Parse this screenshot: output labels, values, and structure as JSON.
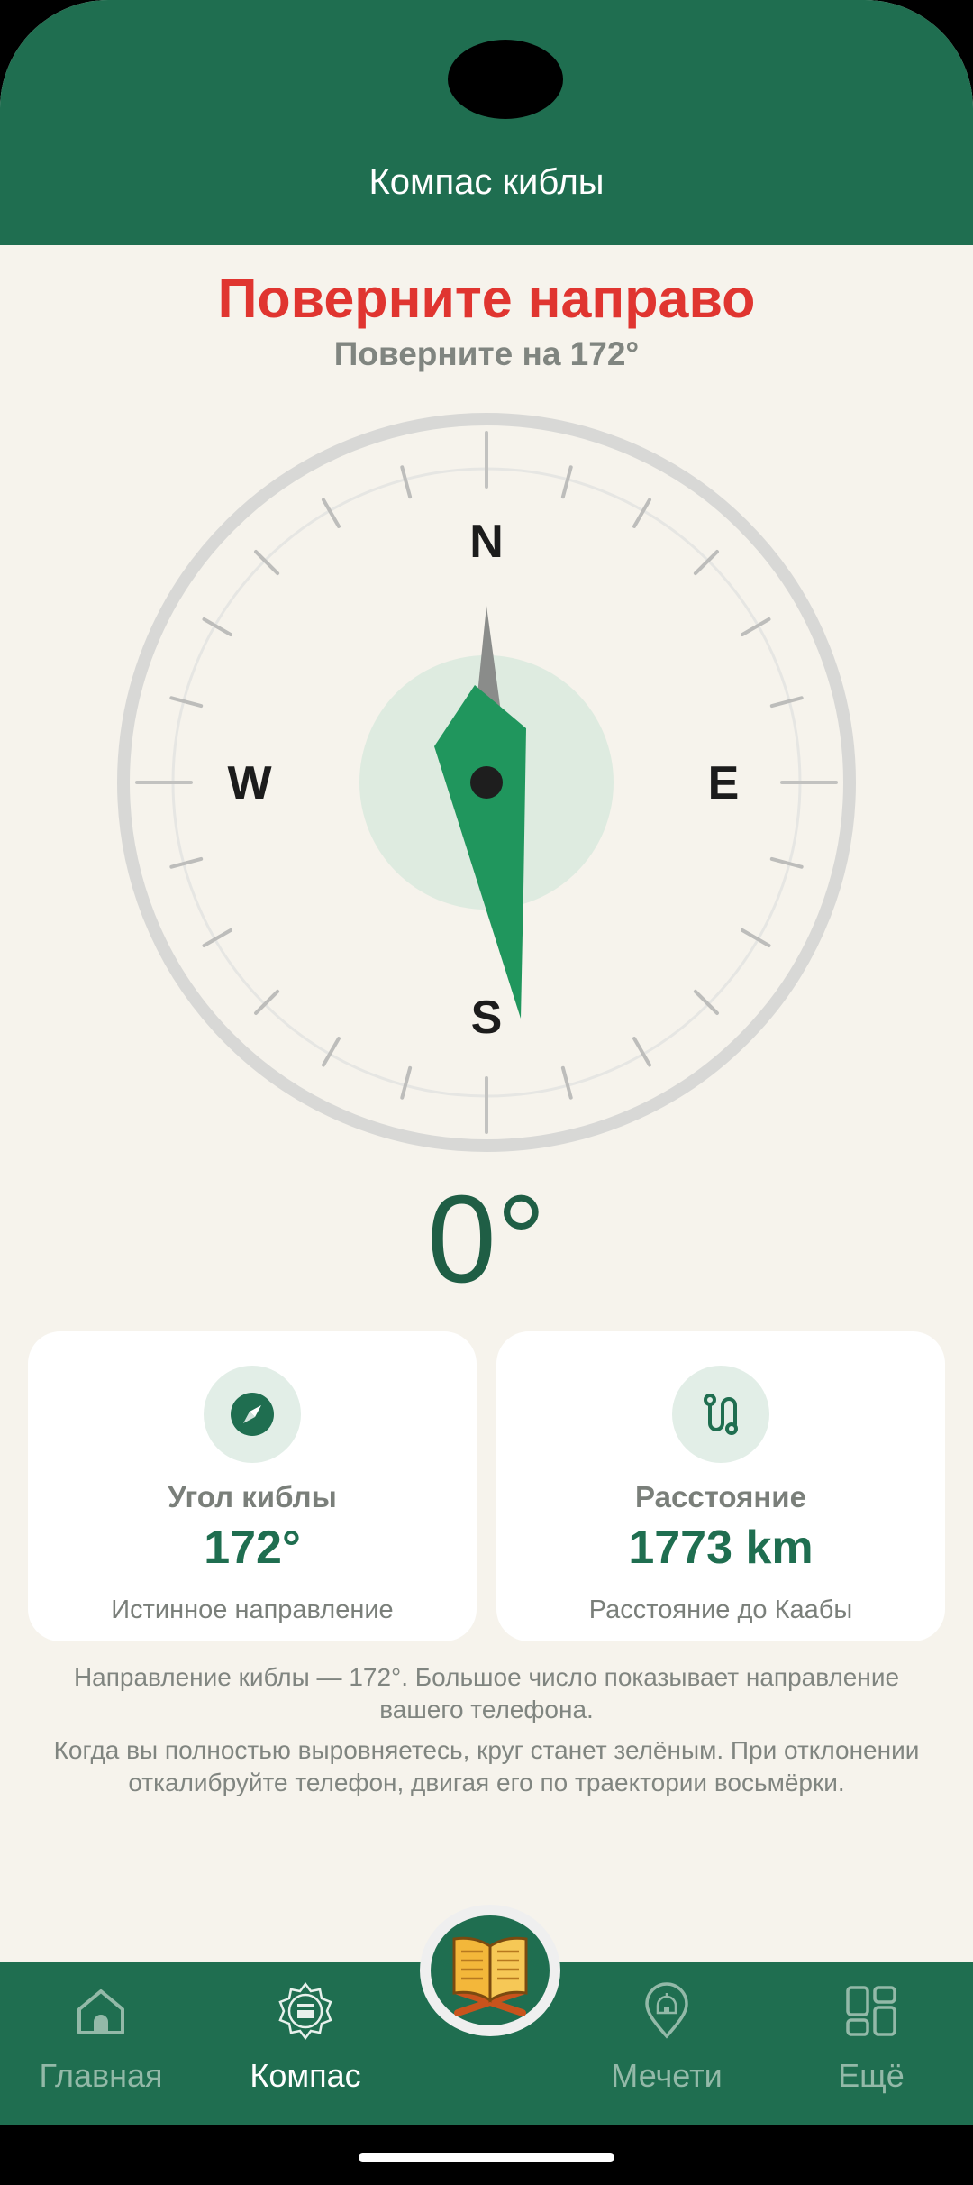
{
  "header": {
    "title": "Компас киблы"
  },
  "status": {
    "headline": "Поверните направо",
    "subline": "Поверните на 172°"
  },
  "compass": {
    "cardinals": {
      "n": "N",
      "e": "E",
      "s": "S",
      "w": "W"
    },
    "heading": "0°",
    "qibla_bearing_deg": 172
  },
  "cards": [
    {
      "icon": "compass-icon",
      "label": "Угол киблы",
      "value": "172°",
      "desc": "Истинное направление"
    },
    {
      "icon": "route-icon",
      "label": "Расстояние",
      "value": "1773 km",
      "desc": "Расстояние до Каабы"
    }
  ],
  "info": {
    "p1": "Направление киблы — 172°. Большое число показывает направление вашего телефона.",
    "p2": "Когда вы полностью выровняетесь, круг станет зелёным. При отклонении откалибруйте телефон, двигая его по траектории восьмёрки."
  },
  "nav": [
    {
      "icon": "home-icon",
      "label": "Главная",
      "active": false
    },
    {
      "icon": "kaaba-compass-icon",
      "label": "Компас",
      "active": true
    },
    {
      "icon": "quran-book-icon",
      "label": "",
      "active": false
    },
    {
      "icon": "mosque-pin-icon",
      "label": "Мечети",
      "active": false
    },
    {
      "icon": "grid-more-icon",
      "label": "Ещё",
      "active": false
    }
  ],
  "colors": {
    "primary": "#1F6E50",
    "accent_green": "#20965D",
    "warning": "#E03530",
    "background": "#F6F3EC"
  }
}
